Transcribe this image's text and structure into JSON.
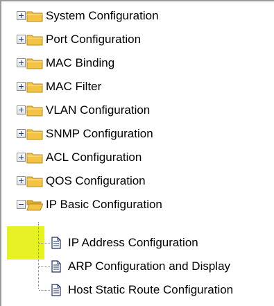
{
  "tree": {
    "folders": [
      {
        "label": "System Configuration",
        "state": "collapsed"
      },
      {
        "label": "Port Configuration",
        "state": "collapsed"
      },
      {
        "label": "MAC Binding",
        "state": "collapsed"
      },
      {
        "label": "MAC Filter",
        "state": "collapsed"
      },
      {
        "label": "VLAN Configuration",
        "state": "collapsed"
      },
      {
        "label": "SNMP Configuration",
        "state": "collapsed"
      },
      {
        "label": "ACL Configuration",
        "state": "collapsed"
      },
      {
        "label": "QOS Configuration",
        "state": "collapsed"
      },
      {
        "label": "IP Basic Configuration",
        "state": "expanded"
      }
    ],
    "children": [
      {
        "label": "IP Address Configuration"
      },
      {
        "label": "ARP Configuration and Display"
      },
      {
        "label": "Host Static Route Configuration"
      }
    ]
  },
  "colors": {
    "highlight": "#e8f026",
    "folder": "#f3c443",
    "expander_sign": "#1c3b8a"
  },
  "icons": {
    "collapsed_folder": "folder-closed-icon",
    "expanded_folder": "folder-open-icon",
    "page": "document-icon",
    "expander_collapsed": "plus-box-icon",
    "expander_expanded": "minus-box-icon"
  }
}
